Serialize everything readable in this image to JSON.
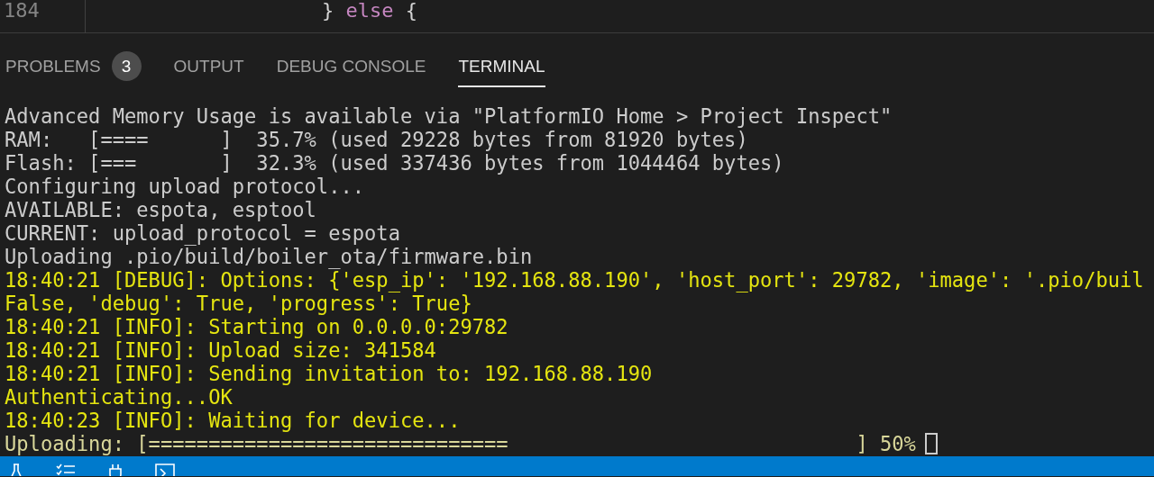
{
  "editor": {
    "line_number": "184",
    "code": [
      {
        "text": "} ",
        "kind": "punct"
      },
      {
        "text": "else",
        "kind": "keyword"
      },
      {
        "text": " {",
        "kind": "punct"
      }
    ]
  },
  "panel_tabs": [
    {
      "label": "PROBLEMS",
      "badge": "3",
      "selected": false
    },
    {
      "label": "OUTPUT",
      "selected": false
    },
    {
      "label": "DEBUG CONSOLE",
      "selected": false
    },
    {
      "label": "TERMINAL",
      "selected": true
    }
  ],
  "terminal": {
    "lines": [
      {
        "text": "Advanced Memory Usage is available via \"PlatformIO Home > Project Inspect\"",
        "kind": "plain"
      },
      {
        "text": "RAM:   [====      ]  35.7% (used 29228 bytes from 81920 bytes)",
        "kind": "plain"
      },
      {
        "text": "Flash: [===       ]  32.3% (used 337436 bytes from 1044464 bytes)",
        "kind": "plain"
      },
      {
        "text": "Configuring upload protocol...",
        "kind": "plain"
      },
      {
        "text": "AVAILABLE: espota, esptool",
        "kind": "plain"
      },
      {
        "text": "CURRENT: upload_protocol = espota",
        "kind": "plain"
      },
      {
        "text": "Uploading .pio/build/boiler_ota/firmware.bin",
        "kind": "plain"
      },
      {
        "text": "18:40:21 [DEBUG]: Options: {'esp_ip': '192.168.88.190', 'host_port': 29782, 'image': '.pio/buil",
        "kind": "log"
      },
      {
        "text": "False, 'debug': True, 'progress': True}",
        "kind": "log"
      },
      {
        "text": "18:40:21 [INFO]: Starting on 0.0.0.0:29782",
        "kind": "log"
      },
      {
        "text": "18:40:21 [INFO]: Upload size: 341584",
        "kind": "log"
      },
      {
        "text": "18:40:21 [INFO]: Sending invitation to: 192.168.88.190",
        "kind": "log"
      },
      {
        "text": "Authenticating...OK",
        "kind": "log"
      },
      {
        "text": "18:40:23 [INFO]: Waiting for device...",
        "kind": "log"
      },
      {
        "text": "Uploading: [==============================                             ] 50%",
        "kind": "progress"
      }
    ]
  }
}
